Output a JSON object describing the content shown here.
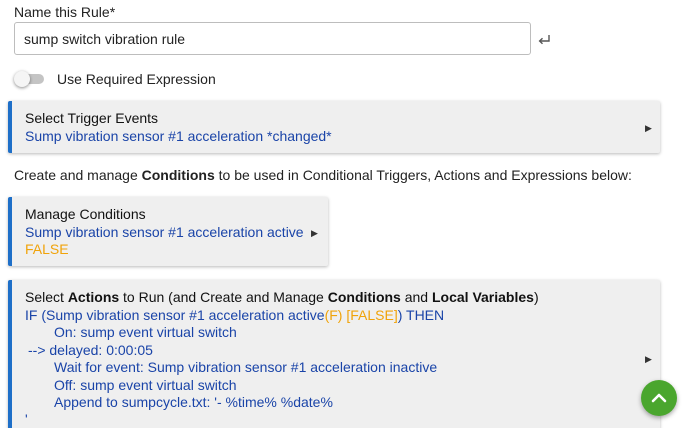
{
  "rule_name": {
    "label": "Name this Rule*",
    "value": "sump switch vibration rule"
  },
  "required_expression": {
    "label": "Use Required Expression",
    "enabled": false
  },
  "trigger_events": {
    "title": "Select Trigger Events",
    "value": "Sump vibration sensor #1 acceleration *changed*"
  },
  "conditions_info": {
    "prefix": "Create and manage ",
    "bold": "Conditions",
    "suffix": " to be used in Conditional Triggers, Actions and Expressions below:"
  },
  "manage_conditions": {
    "title": "Manage Conditions",
    "condition": "Sump vibration sensor #1 acceleration active",
    "state": "FALSE"
  },
  "actions": {
    "title_parts": {
      "p1": "Select ",
      "b1": "Actions",
      "p2": " to Run (and Create and Manage ",
      "b2": "Conditions",
      "p3": " and ",
      "b3": "Local Variables",
      "p4": ")"
    },
    "if_line": {
      "prefix": "IF (Sump vibration sensor #1 acceleration active",
      "flag": "(F) [FALSE]",
      "suffix": ") THEN"
    },
    "lines": [
      "On: sump event virtual switch",
      "--> delayed: 0:00:05",
      "Wait for event: Sump vibration sensor #1 acceleration inactive",
      "Off: sump event virtual switch",
      "Append to sumpcycle.txt: '- %time% %date%",
      "'"
    ]
  },
  "icons": {
    "enter": "keyboard-return-icon",
    "expand": "triangle-right-icon",
    "scroll_top": "chevron-up-icon"
  },
  "colors": {
    "accent_blue": "#1e6fc8",
    "value_blue": "#1a44a8",
    "state_orange": "#f0a30a",
    "fab_green": "#4aa62e"
  }
}
